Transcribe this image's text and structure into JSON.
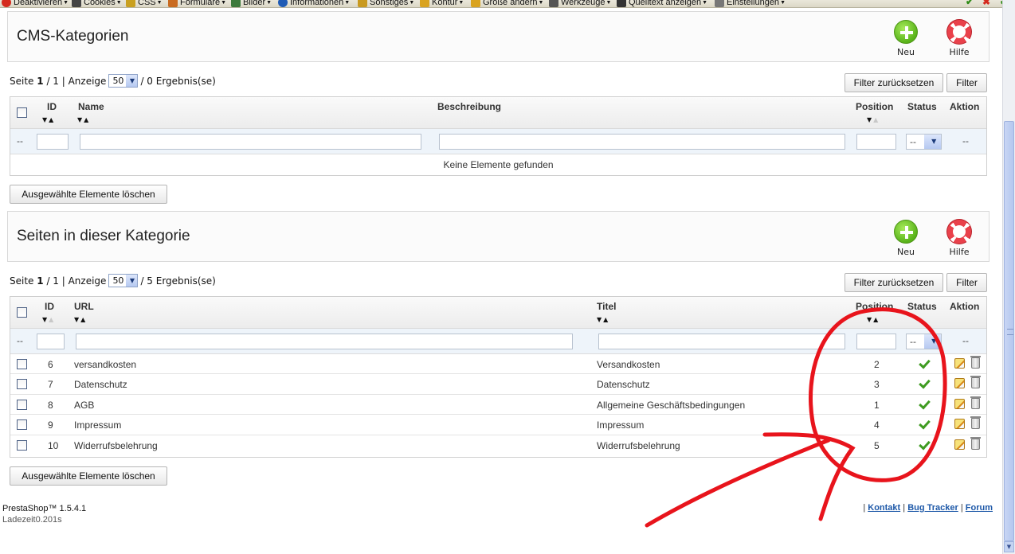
{
  "devbar": {
    "items": [
      {
        "label": "Deaktivieren",
        "icon": "disable-icon",
        "color": "#d42a1e"
      },
      {
        "label": "Cookies",
        "icon": "cookie-icon",
        "color": "#333333"
      },
      {
        "label": "CSS",
        "icon": "css-pencil-icon",
        "color": "#c9a020"
      },
      {
        "label": "Formulare",
        "icon": "form-icon",
        "color": "#c96b20"
      },
      {
        "label": "Bilder",
        "icon": "image-icon",
        "color": "#3d7a3d"
      },
      {
        "label": "Informationen",
        "icon": "info-icon",
        "color": "#1f5bb5"
      },
      {
        "label": "Sonstiges",
        "icon": "misc-icon",
        "color": "#c99a20"
      },
      {
        "label": "Kontur",
        "icon": "outline-icon",
        "color": "#d9a320"
      },
      {
        "label": "Größe ändern",
        "icon": "resize-icon",
        "color": "#d9a320"
      },
      {
        "label": "Werkzeuge",
        "icon": "tools-icon",
        "color": "#555555"
      },
      {
        "label": "Quelltext anzeigen",
        "icon": "source-icon",
        "color": "#333333"
      },
      {
        "label": "Einstellungen",
        "icon": "settings-icon",
        "color": "#777777"
      }
    ]
  },
  "cms_categories": {
    "title": "CMS-Kategorien",
    "new_label": "Neu",
    "help_label": "Hilfe",
    "pager": {
      "page_label": "Seite",
      "page": "1",
      "of": "/ 1 | Anzeige",
      "per_page": "50",
      "results": "/ 0 Ergebnis(se)"
    },
    "reset_filter": "Filter zurücksetzen",
    "filter": "Filter",
    "columns": {
      "id": "ID",
      "name": "Name",
      "description": "Beschreibung",
      "position": "Position",
      "status": "Status",
      "action": "Aktion"
    },
    "filter_row": {
      "dash": "--",
      "status_value": "--",
      "action_dash": "--"
    },
    "empty": "Keine Elemente gefunden",
    "delete_selected": "Ausgewählte Elemente löschen"
  },
  "cms_pages": {
    "title": "Seiten in dieser Kategorie",
    "new_label": "Neu",
    "help_label": "Hilfe",
    "pager": {
      "page_label": "Seite",
      "page": "1",
      "of": "/ 1 | Anzeige",
      "per_page": "50",
      "results": "/ 5 Ergebnis(se)"
    },
    "reset_filter": "Filter zurücksetzen",
    "filter": "Filter",
    "columns": {
      "id": "ID",
      "url": "URL",
      "title": "Titel",
      "position": "Position",
      "status": "Status",
      "action": "Aktion"
    },
    "filter_row": {
      "dash": "--",
      "status_value": "--",
      "action_dash": "--"
    },
    "rows": [
      {
        "id": "6",
        "url": "versandkosten",
        "title": "Versandkosten",
        "position": "2",
        "enabled": true
      },
      {
        "id": "7",
        "url": "Datenschutz",
        "title": "Datenschutz",
        "position": "3",
        "enabled": true
      },
      {
        "id": "8",
        "url": "AGB",
        "title": "Allgemeine Geschäftsbedingungen",
        "position": "1",
        "enabled": true
      },
      {
        "id": "9",
        "url": "Impressum",
        "title": "Impressum",
        "position": "4",
        "enabled": true
      },
      {
        "id": "10",
        "url": "Widerrufsbelehrung",
        "title": "Widerrufsbelehrung",
        "position": "5",
        "enabled": true
      }
    ],
    "delete_selected": "Ausgewählte Elemente löschen"
  },
  "footer": {
    "version": "PrestaShop™ 1.5.4.1",
    "load_time": "Ladezeit0.201s",
    "links": [
      "Kontakt",
      "Bug Tracker",
      "Forum"
    ]
  },
  "colors": {
    "annotation": "#e8141c",
    "status_ok": "#3f9b21",
    "link": "#1d58a8"
  }
}
